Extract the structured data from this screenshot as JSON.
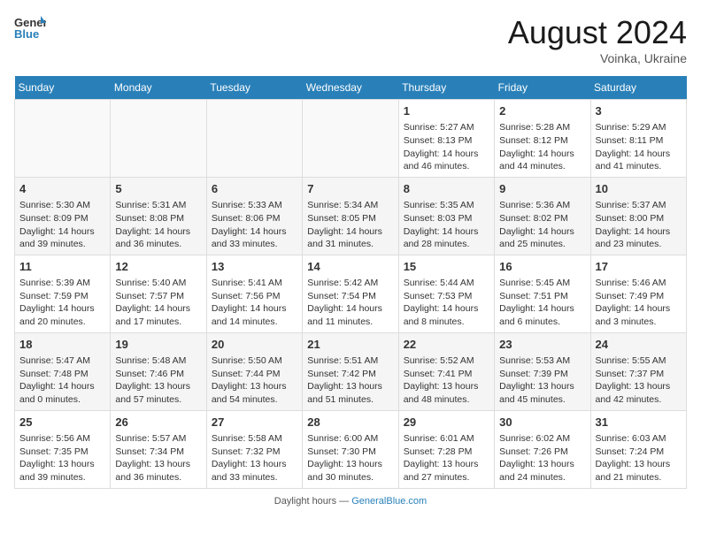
{
  "header": {
    "logo_line1": "General",
    "logo_line2": "Blue",
    "month": "August 2024",
    "location": "Voinka, Ukraine"
  },
  "weekdays": [
    "Sunday",
    "Monday",
    "Tuesday",
    "Wednesday",
    "Thursday",
    "Friday",
    "Saturday"
  ],
  "weeks": [
    [
      {
        "day": "",
        "info": ""
      },
      {
        "day": "",
        "info": ""
      },
      {
        "day": "",
        "info": ""
      },
      {
        "day": "",
        "info": ""
      },
      {
        "day": "1",
        "info": "Sunrise: 5:27 AM\nSunset: 8:13 PM\nDaylight: 14 hours and 46 minutes."
      },
      {
        "day": "2",
        "info": "Sunrise: 5:28 AM\nSunset: 8:12 PM\nDaylight: 14 hours and 44 minutes."
      },
      {
        "day": "3",
        "info": "Sunrise: 5:29 AM\nSunset: 8:11 PM\nDaylight: 14 hours and 41 minutes."
      }
    ],
    [
      {
        "day": "4",
        "info": "Sunrise: 5:30 AM\nSunset: 8:09 PM\nDaylight: 14 hours and 39 minutes."
      },
      {
        "day": "5",
        "info": "Sunrise: 5:31 AM\nSunset: 8:08 PM\nDaylight: 14 hours and 36 minutes."
      },
      {
        "day": "6",
        "info": "Sunrise: 5:33 AM\nSunset: 8:06 PM\nDaylight: 14 hours and 33 minutes."
      },
      {
        "day": "7",
        "info": "Sunrise: 5:34 AM\nSunset: 8:05 PM\nDaylight: 14 hours and 31 minutes."
      },
      {
        "day": "8",
        "info": "Sunrise: 5:35 AM\nSunset: 8:03 PM\nDaylight: 14 hours and 28 minutes."
      },
      {
        "day": "9",
        "info": "Sunrise: 5:36 AM\nSunset: 8:02 PM\nDaylight: 14 hours and 25 minutes."
      },
      {
        "day": "10",
        "info": "Sunrise: 5:37 AM\nSunset: 8:00 PM\nDaylight: 14 hours and 23 minutes."
      }
    ],
    [
      {
        "day": "11",
        "info": "Sunrise: 5:39 AM\nSunset: 7:59 PM\nDaylight: 14 hours and 20 minutes."
      },
      {
        "day": "12",
        "info": "Sunrise: 5:40 AM\nSunset: 7:57 PM\nDaylight: 14 hours and 17 minutes."
      },
      {
        "day": "13",
        "info": "Sunrise: 5:41 AM\nSunset: 7:56 PM\nDaylight: 14 hours and 14 minutes."
      },
      {
        "day": "14",
        "info": "Sunrise: 5:42 AM\nSunset: 7:54 PM\nDaylight: 14 hours and 11 minutes."
      },
      {
        "day": "15",
        "info": "Sunrise: 5:44 AM\nSunset: 7:53 PM\nDaylight: 14 hours and 8 minutes."
      },
      {
        "day": "16",
        "info": "Sunrise: 5:45 AM\nSunset: 7:51 PM\nDaylight: 14 hours and 6 minutes."
      },
      {
        "day": "17",
        "info": "Sunrise: 5:46 AM\nSunset: 7:49 PM\nDaylight: 14 hours and 3 minutes."
      }
    ],
    [
      {
        "day": "18",
        "info": "Sunrise: 5:47 AM\nSunset: 7:48 PM\nDaylight: 14 hours and 0 minutes."
      },
      {
        "day": "19",
        "info": "Sunrise: 5:48 AM\nSunset: 7:46 PM\nDaylight: 13 hours and 57 minutes."
      },
      {
        "day": "20",
        "info": "Sunrise: 5:50 AM\nSunset: 7:44 PM\nDaylight: 13 hours and 54 minutes."
      },
      {
        "day": "21",
        "info": "Sunrise: 5:51 AM\nSunset: 7:42 PM\nDaylight: 13 hours and 51 minutes."
      },
      {
        "day": "22",
        "info": "Sunrise: 5:52 AM\nSunset: 7:41 PM\nDaylight: 13 hours and 48 minutes."
      },
      {
        "day": "23",
        "info": "Sunrise: 5:53 AM\nSunset: 7:39 PM\nDaylight: 13 hours and 45 minutes."
      },
      {
        "day": "24",
        "info": "Sunrise: 5:55 AM\nSunset: 7:37 PM\nDaylight: 13 hours and 42 minutes."
      }
    ],
    [
      {
        "day": "25",
        "info": "Sunrise: 5:56 AM\nSunset: 7:35 PM\nDaylight: 13 hours and 39 minutes."
      },
      {
        "day": "26",
        "info": "Sunrise: 5:57 AM\nSunset: 7:34 PM\nDaylight: 13 hours and 36 minutes."
      },
      {
        "day": "27",
        "info": "Sunrise: 5:58 AM\nSunset: 7:32 PM\nDaylight: 13 hours and 33 minutes."
      },
      {
        "day": "28",
        "info": "Sunrise: 6:00 AM\nSunset: 7:30 PM\nDaylight: 13 hours and 30 minutes."
      },
      {
        "day": "29",
        "info": "Sunrise: 6:01 AM\nSunset: 7:28 PM\nDaylight: 13 hours and 27 minutes."
      },
      {
        "day": "30",
        "info": "Sunrise: 6:02 AM\nSunset: 7:26 PM\nDaylight: 13 hours and 24 minutes."
      },
      {
        "day": "31",
        "info": "Sunrise: 6:03 AM\nSunset: 7:24 PM\nDaylight: 13 hours and 21 minutes."
      }
    ]
  ],
  "footer": {
    "text": "Daylight hours",
    "url_text": "GeneralBlue.com"
  }
}
